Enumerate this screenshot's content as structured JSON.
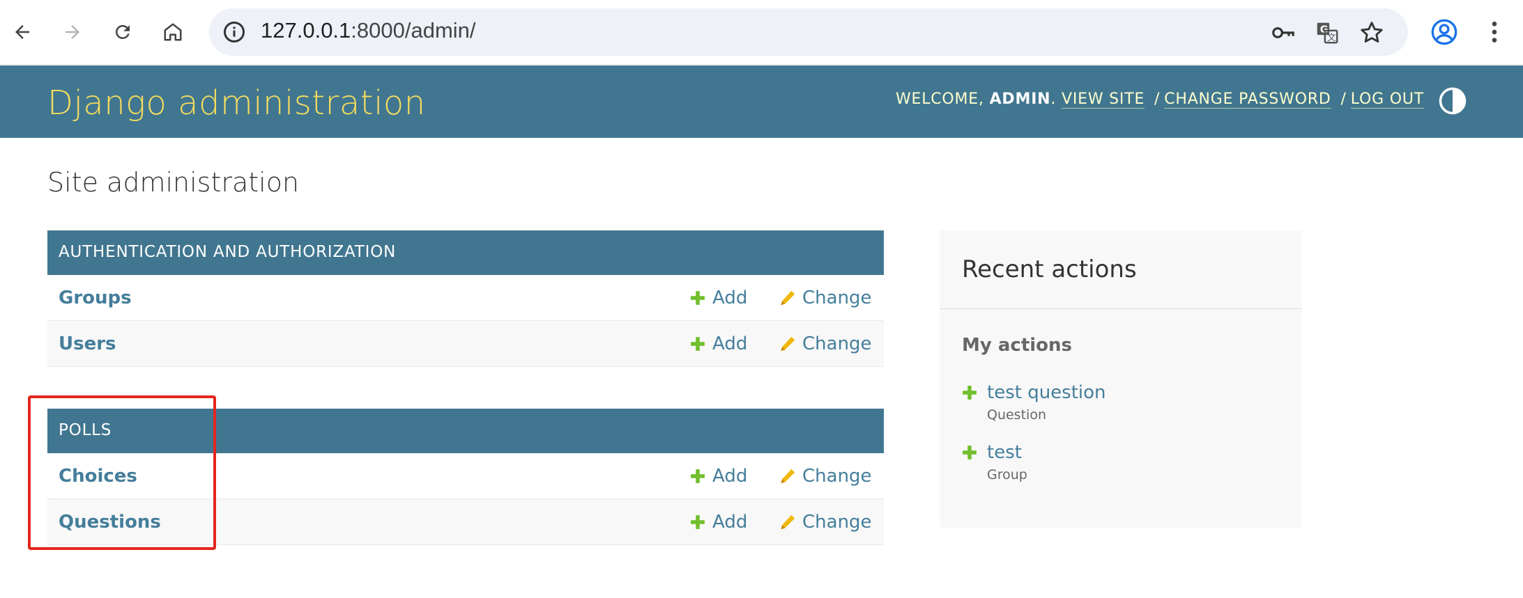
{
  "browser": {
    "url_host": "127.0.0.1",
    "url_rest": ":8000/admin/"
  },
  "header": {
    "branding": "Django administration",
    "welcome": "WELCOME,",
    "username": "ADMIN",
    "view_site": "VIEW SITE",
    "change_password": "CHANGE PASSWORD",
    "log_out": "LOG OUT",
    "separator": "/"
  },
  "page_title": "Site administration",
  "modules": [
    {
      "caption": "AUTHENTICATION AND AUTHORIZATION",
      "rows": [
        {
          "model": "Groups",
          "add": "Add",
          "change": "Change"
        },
        {
          "model": "Users",
          "add": "Add",
          "change": "Change"
        }
      ]
    },
    {
      "caption": "POLLS",
      "rows": [
        {
          "model": "Choices",
          "add": "Add",
          "change": "Change"
        },
        {
          "model": "Questions",
          "add": "Add",
          "change": "Change"
        }
      ]
    }
  ],
  "recent_actions": {
    "title": "Recent actions",
    "subtitle": "My actions",
    "items": [
      {
        "name": "test question",
        "type": "Question"
      },
      {
        "name": "test",
        "type": "Group"
      }
    ]
  },
  "colors": {
    "header_bg": "#417690",
    "branding": "#f5dd5d",
    "link": "#447e9b",
    "add_icon": "#70bf2b",
    "change_icon": "#efb80b",
    "highlight": "#e4261f"
  }
}
